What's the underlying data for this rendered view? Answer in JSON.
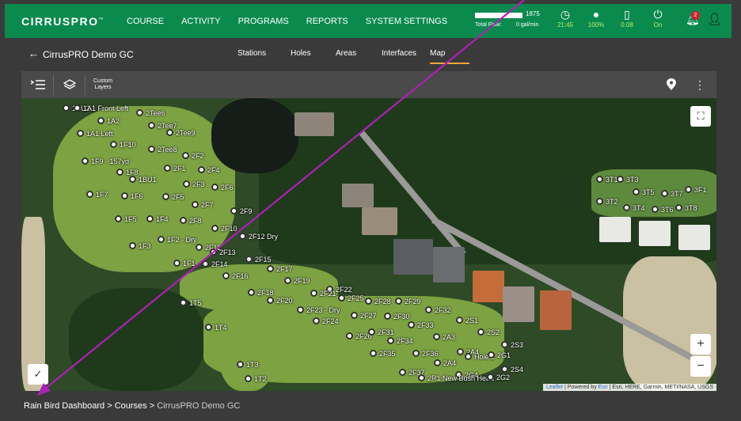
{
  "app": {
    "logo_main": "CIRRUS",
    "logo_pro": "PRO",
    "logo_tm": "™"
  },
  "nav": [
    "COURSE",
    "ACTIVITY",
    "PROGRAMS",
    "REPORTS",
    "SYSTEM SETTINGS"
  ],
  "flow": {
    "max": "1875",
    "label": "Total Flow:",
    "value": "0 gal/min",
    "fill_fraction": 0
  },
  "stats": [
    {
      "icon": "clock-icon",
      "glyph": "◷",
      "value": "21:45"
    },
    {
      "icon": "water-drop-icon",
      "glyph": "💧",
      "value": "100%"
    },
    {
      "icon": "battery-meter-icon",
      "glyph": "▯",
      "value": "0.08"
    },
    {
      "icon": "power-icon",
      "glyph": "⏻",
      "value": "On"
    }
  ],
  "notifications": {
    "count": "2"
  },
  "subnav": {
    "title": "CirrusPRO Demo GC",
    "tabs": [
      "Stations",
      "Holes",
      "Areas",
      "Interfaces",
      "Map"
    ],
    "active_tab": "Map"
  },
  "toolbar": {
    "custom_layers_line1": "Custom",
    "custom_layers_line2": "Layers"
  },
  "map": {
    "zoom_in": "+",
    "zoom_out": "−",
    "attribution_leaflet": "Leaflet",
    "attribution_powered": " | Powered by ",
    "attribution_esri": "Esri",
    "attribution_rest": " | Esri, HERE, Garmin, METI/NASA, USGS",
    "stations": [
      {
        "label": "1BU2"
      },
      {
        "label": "1A1 Front Left"
      },
      {
        "label": "2Tee6"
      },
      {
        "label": "1A2"
      },
      {
        "label": "2Tee7"
      },
      {
        "label": "1A1 Left"
      },
      {
        "label": "2Tee9"
      },
      {
        "label": "1F10"
      },
      {
        "label": "2Tee8"
      },
      {
        "label": "2F2"
      },
      {
        "label": "1F9 - 157yd"
      },
      {
        "label": "2F1"
      },
      {
        "label": "2F4"
      },
      {
        "label": "1F8"
      },
      {
        "label": "1BU1"
      },
      {
        "label": "2F3"
      },
      {
        "label": "2F6"
      },
      {
        "label": "1F7"
      },
      {
        "label": "1F6"
      },
      {
        "label": "2F5"
      },
      {
        "label": "2F7"
      },
      {
        "label": "2F9"
      },
      {
        "label": "1F5"
      },
      {
        "label": "1F4"
      },
      {
        "label": "2F8"
      },
      {
        "label": "2F10"
      },
      {
        "label": "2F12 Dry"
      },
      {
        "label": "1F2 - Dry"
      },
      {
        "label": "1F3"
      },
      {
        "label": "2F11"
      },
      {
        "label": "2F13"
      },
      {
        "label": "1F1"
      },
      {
        "label": "2F14"
      },
      {
        "label": "2F15"
      },
      {
        "label": "2F17"
      },
      {
        "label": "2F16"
      },
      {
        "label": "2F19"
      },
      {
        "label": "2F22"
      },
      {
        "label": "2F21"
      },
      {
        "label": "2F18"
      },
      {
        "label": "2F25"
      },
      {
        "label": "2F28"
      },
      {
        "label": "2F29"
      },
      {
        "label": "1T5"
      },
      {
        "label": "2F20"
      },
      {
        "label": "2F23 - Dry"
      },
      {
        "label": "2F27"
      },
      {
        "label": "2F30"
      },
      {
        "label": "2F32"
      },
      {
        "label": "2F24"
      },
      {
        "label": "2S1"
      },
      {
        "label": "2F33"
      },
      {
        "label": "1T4"
      },
      {
        "label": "2F26"
      },
      {
        "label": "2F31"
      },
      {
        "label": "2S2"
      },
      {
        "label": "2A3"
      },
      {
        "label": "2F34"
      },
      {
        "label": "2S3"
      },
      {
        "label": "2A4"
      },
      {
        "label": "2F35"
      },
      {
        "label": "2F36"
      },
      {
        "label": "Hole 2"
      },
      {
        "label": "2G1"
      },
      {
        "label": "1T3"
      },
      {
        "label": "2A4"
      },
      {
        "label": "2S4"
      },
      {
        "label": "2F37"
      },
      {
        "label": "2G4"
      },
      {
        "label": "1T2"
      },
      {
        "label": "2R1 New Bush Head"
      },
      {
        "label": "2G2"
      },
      {
        "label": "3T1"
      },
      {
        "label": "3T3"
      },
      {
        "label": "3T5"
      },
      {
        "label": "3T7"
      },
      {
        "label": "3F1"
      },
      {
        "label": "3T2"
      },
      {
        "label": "3T4"
      },
      {
        "label": "3T6"
      },
      {
        "label": "3T8"
      }
    ]
  },
  "breadcrumb": {
    "item1": "Rain Bird Dashboard",
    "sep": ">",
    "item2": "Courses",
    "item3": "CirrusPRO Demo GC"
  },
  "colors": {
    "brand_green": "#0b8a4e",
    "accent": "#f2a33a",
    "annotation_arrow": "#b01fb8"
  }
}
